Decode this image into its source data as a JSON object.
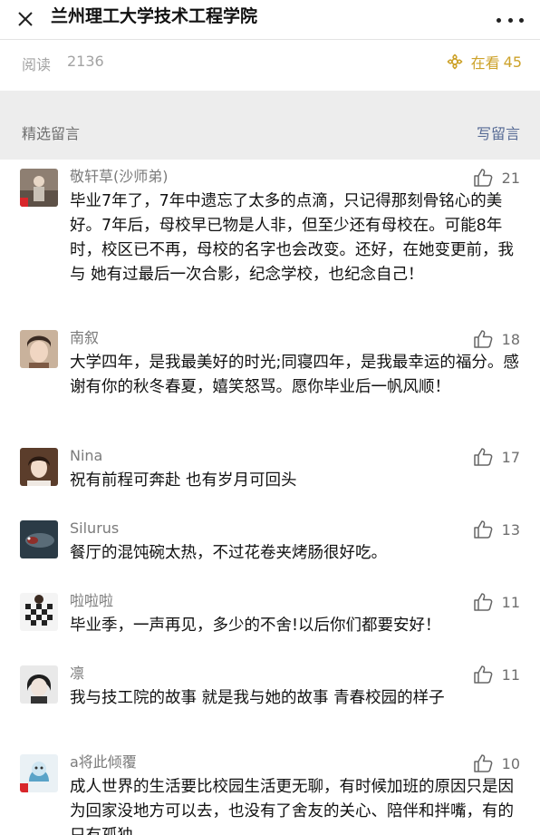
{
  "header": {
    "title": "兰州理工大学技术工程学院"
  },
  "stats": {
    "read_label": "阅读",
    "read_count": "2136",
    "watching_label": "在看",
    "watching_count": "45"
  },
  "section": {
    "title": "精选留言",
    "write_label": "写留言"
  },
  "colors": {
    "accent_gold": "#cda22a",
    "link_blue": "#576b95"
  },
  "comments": [
    {
      "nickname": "敬轩草(沙师弟)",
      "likes": "21",
      "text": "毕业7年了，7年中遗忘了太多的点滴，只记得那刻骨铭心的美好。7年后，母校早已物是人非，但至少还有母校在。可能8年时，校区已不再，母校的名字也会改变。还好，在她变更前，我与 她有过最后一次合影，纪念学校，也纪念自己！"
    },
    {
      "nickname": "南叙",
      "likes": "18",
      "text": "大学四年，是我最美好的时光;同寝四年，是我最幸运的福分。感谢有你的秋冬春夏，嬉笑怒骂。愿你毕业后一帆风顺！"
    },
    {
      "nickname": "Nina",
      "likes": "17",
      "text": "祝有前程可奔赴 也有岁月可回头"
    },
    {
      "nickname": "Silurus",
      "likes": "13",
      "text": "餐厅的混饨碗太热，不过花卷夹烤肠很好吃。"
    },
    {
      "nickname": "啦啦啦",
      "likes": "11",
      "text": "毕业季，一声再见，多少的不舍!以后你们都要安好！"
    },
    {
      "nickname": "凛",
      "likes": "11",
      "text": "我与技工院的故事 就是我与她的故事 青春校园的样子"
    },
    {
      "nickname": "a将此倾覆",
      "likes": "10",
      "text": "成人世界的生活要比校园生活更无聊，有时候加班的原因只是因为回家没地方可以去，也没有了舍友的关心、陪伴和拌嘴，有的只有孤独"
    }
  ]
}
